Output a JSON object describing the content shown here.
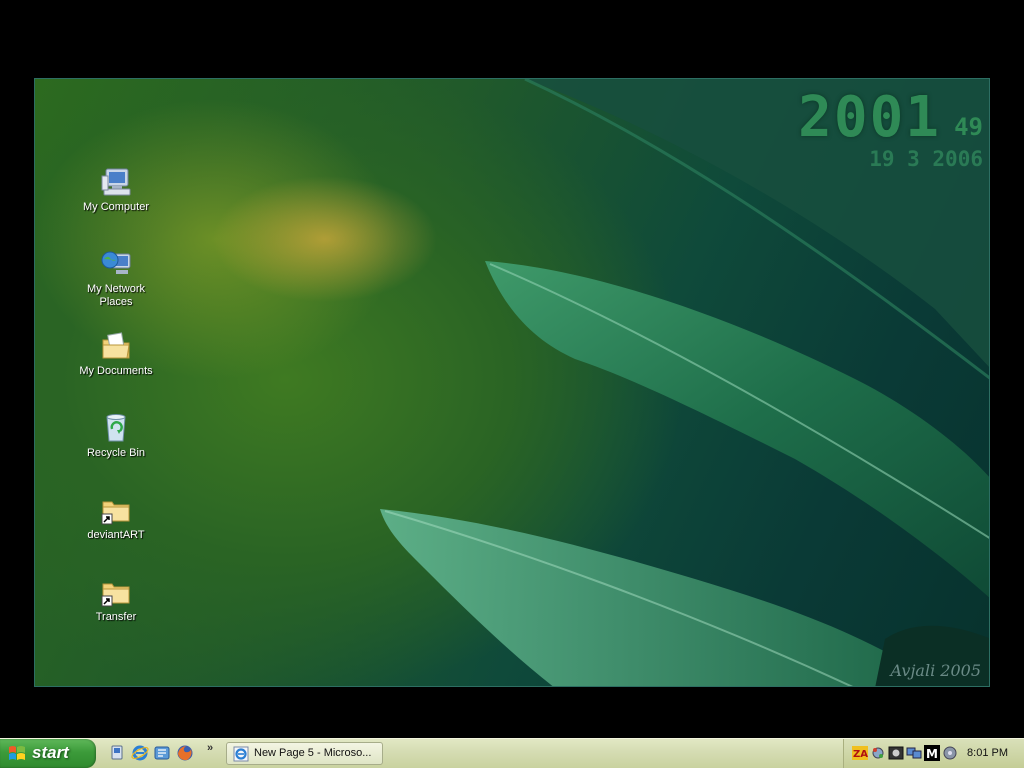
{
  "wallpaper": {
    "clock": {
      "time": "2001",
      "seconds": "49",
      "date": "19 3 2006"
    },
    "signature": "Avjali 2005"
  },
  "desktop_icons": [
    {
      "label": "My Computer",
      "icon": "my-computer-icon"
    },
    {
      "label": "My Network Places",
      "icon": "network-places-icon"
    },
    {
      "label": "My Documents",
      "icon": "my-documents-icon"
    },
    {
      "label": "Recycle Bin",
      "icon": "recycle-bin-icon"
    },
    {
      "label": "deviantART",
      "icon": "folder-shortcut-icon"
    },
    {
      "label": "Transfer",
      "icon": "folder-shortcut-icon"
    }
  ],
  "taskbar": {
    "start_label": "start",
    "quick_launch": [
      "show-desktop-icon",
      "internet-explorer-icon",
      "outlook-express-icon",
      "firefox-icon"
    ],
    "overflow_chevron": "»",
    "tasks": [
      {
        "label": "New Page 5 - Microso...",
        "icon": "internet-explorer-icon"
      }
    ],
    "tray_icons": [
      "zonealarm-icon",
      "network-tool-icon",
      "media-icon",
      "network-connection-icon",
      "messenger-m-icon",
      "volume-icon"
    ],
    "clock": "8:01 PM"
  },
  "colors": {
    "start_green": "#3c9b3a",
    "taskbar": "#d6ddb4",
    "clock_green": "#2f8a56"
  }
}
